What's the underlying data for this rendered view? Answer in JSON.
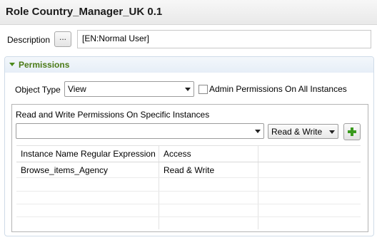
{
  "editor": {
    "title": "Role Country_Manager_UK 0.1"
  },
  "description": {
    "label": "Description",
    "browse_label": "...",
    "value": "[EN:Normal User]"
  },
  "permissions": {
    "section_label": "Permissions",
    "object_type_label": "Object Type",
    "object_type_value": "View",
    "admin_checkbox_label": "Admin Permissions On All Instances",
    "admin_checked": false,
    "instances_group_label": "Read and Write Permissions On Specific Instances",
    "instance_input_value": "",
    "access_select_value": "Read & Write",
    "table": {
      "columns": [
        "Instance Name Regular Expression",
        "Access"
      ],
      "rows": [
        {
          "instance": "Browse_items_Agency",
          "access": "Read & Write"
        }
      ]
    }
  },
  "colors": {
    "section_header_text": "#4a7a16",
    "add_icon": "#3a9a1e"
  },
  "icons": {
    "expand": "triangle-down-icon",
    "add": "plus-icon",
    "dropdown": "chevron-down-icon"
  }
}
